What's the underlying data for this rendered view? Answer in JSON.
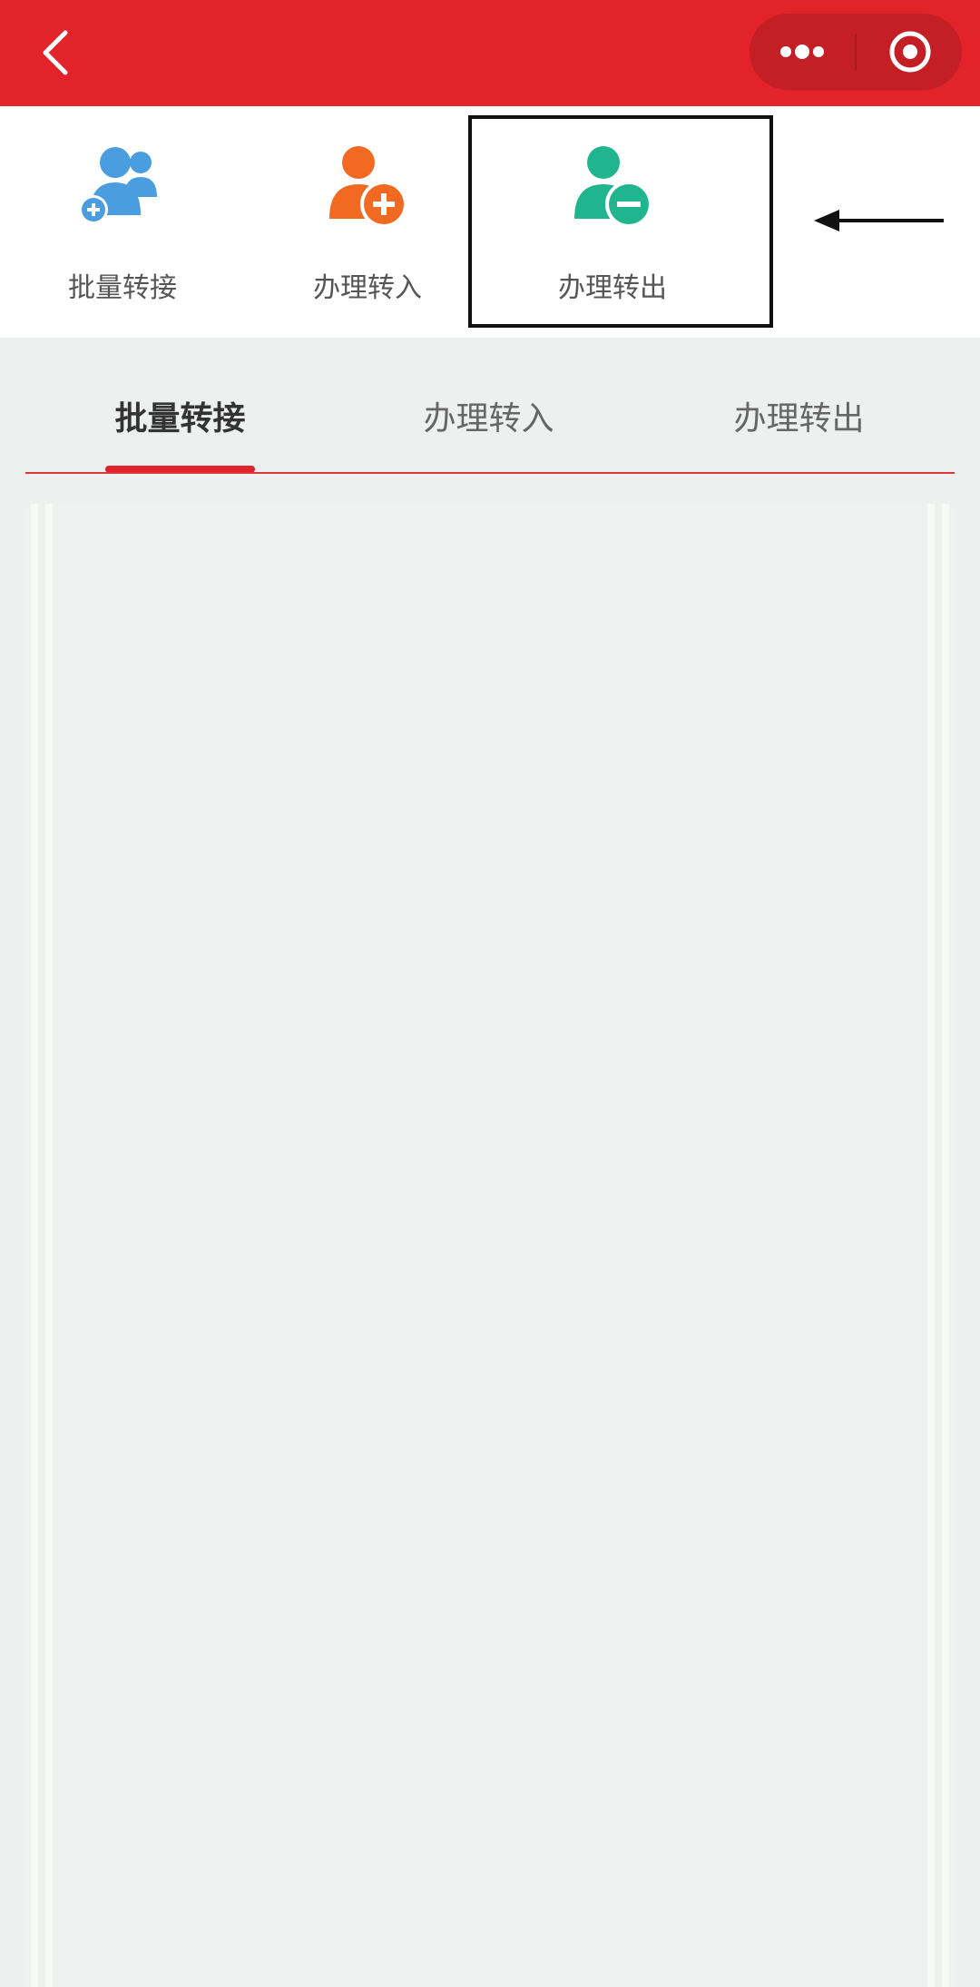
{
  "topbar": {
    "back_icon": "chevron-left-icon",
    "more_icon": "more-dots-icon",
    "close_icon": "target-circle-icon",
    "color": "#e2242a"
  },
  "quick_actions": [
    {
      "label": "批量转接",
      "icon": "users-add-icon",
      "color": "#4a9ee0"
    },
    {
      "label": "办理转入",
      "icon": "user-plus-icon",
      "color": "#f26a21"
    },
    {
      "label": "办理转出",
      "icon": "user-minus-icon",
      "color": "#20b58e"
    }
  ],
  "annotation": {
    "arrow_icon": "left-arrow-icon"
  },
  "tabs": [
    {
      "label": "批量转接",
      "active": true
    },
    {
      "label": "办理转入",
      "active": false
    },
    {
      "label": "办理转出",
      "active": false
    }
  ],
  "colors": {
    "accent": "#e2242a",
    "background": "#eef0ef"
  }
}
